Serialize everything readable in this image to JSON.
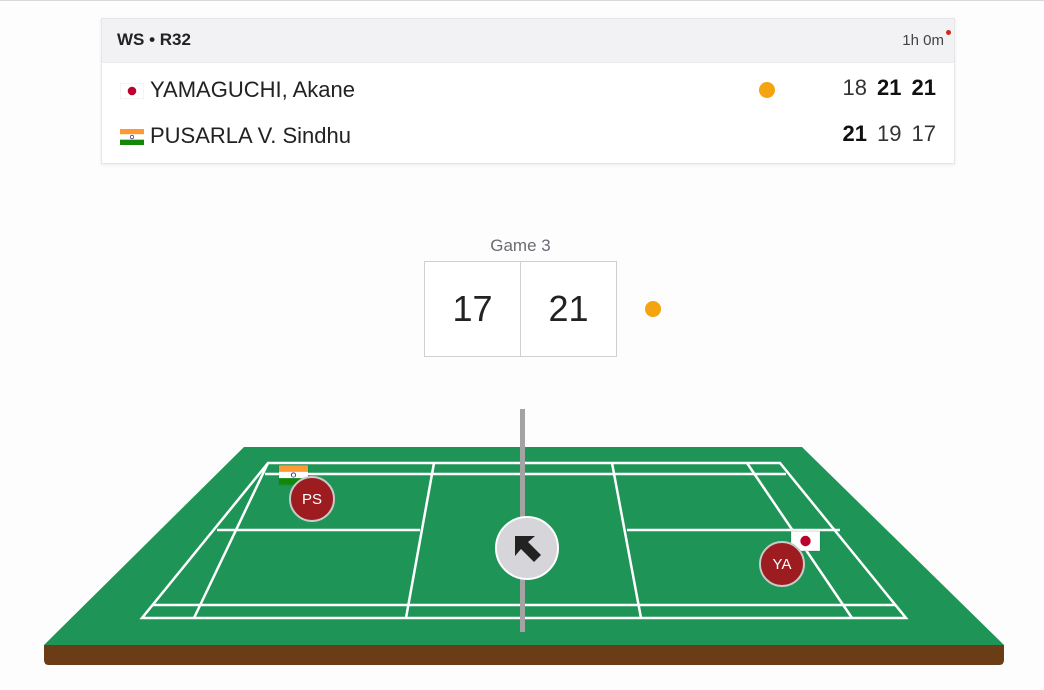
{
  "match": {
    "event": "WS • R32",
    "duration": "1h 0m",
    "players": [
      {
        "name": "YAMAGUCHI, Akane",
        "flag_icon": "japan-flag-icon",
        "serving": true,
        "games": [
          {
            "score": "18",
            "won": false
          },
          {
            "score": "21",
            "won": true
          },
          {
            "score": "21",
            "won": true
          }
        ]
      },
      {
        "name": "PUSARLA V. Sindhu",
        "flag_icon": "india-flag-icon",
        "serving": false,
        "games": [
          {
            "score": "21",
            "won": true
          },
          {
            "score": "19",
            "won": false
          },
          {
            "score": "17",
            "won": false
          }
        ]
      }
    ]
  },
  "current_game": {
    "label": "Game 3",
    "left_score": "17",
    "right_score": "21"
  },
  "court": {
    "left_player_initials": "PS",
    "right_player_initials": "YA",
    "shuttle_direction_icon": "arrow-up-left-icon"
  },
  "colors": {
    "serve_indicator": "#f5a30f",
    "court_green": "#1e9457",
    "player_token": "#9c1c20",
    "live_indicator": "#d4261c"
  }
}
